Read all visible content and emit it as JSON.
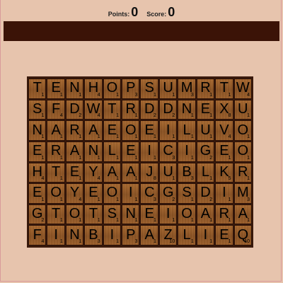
{
  "header": {
    "points_label": "Points:",
    "points_value": "0",
    "score_label": "Score:",
    "score_value": "0"
  },
  "board": {
    "rows": [
      [
        [
          "T",
          "1"
        ],
        [
          "E",
          "1"
        ],
        [
          "N",
          "1"
        ],
        [
          "H",
          "4"
        ],
        [
          "O",
          "1"
        ],
        [
          "P",
          "3"
        ],
        [
          "S",
          "1"
        ],
        [
          "U",
          "1"
        ],
        [
          "M",
          "3"
        ],
        [
          "R",
          "1"
        ],
        [
          "T",
          "1"
        ],
        [
          "W",
          "4"
        ]
      ],
      [
        [
          "S",
          "1"
        ],
        [
          "F",
          "4"
        ],
        [
          "D",
          "2"
        ],
        [
          "W",
          "4"
        ],
        [
          "T",
          "1"
        ],
        [
          "R",
          "1"
        ],
        [
          "D",
          "2"
        ],
        [
          "D",
          "2"
        ],
        [
          "N",
          "1"
        ],
        [
          "E",
          "1"
        ],
        [
          "X",
          "8"
        ],
        [
          "U",
          "1"
        ]
      ],
      [
        [
          "N",
          "1"
        ],
        [
          "A",
          "1"
        ],
        [
          "R",
          "1"
        ],
        [
          "A",
          "1"
        ],
        [
          "E",
          "1"
        ],
        [
          "O",
          "1"
        ],
        [
          "E",
          "1"
        ],
        [
          "I",
          "1"
        ],
        [
          "L",
          "1"
        ],
        [
          "U",
          "1"
        ],
        [
          "V",
          "4"
        ],
        [
          "O",
          "1"
        ]
      ],
      [
        [
          "E",
          "1"
        ],
        [
          "R",
          "1"
        ],
        [
          "A",
          "1"
        ],
        [
          "N",
          "1"
        ],
        [
          "L",
          "1"
        ],
        [
          "E",
          "1"
        ],
        [
          "I",
          "1"
        ],
        [
          "C",
          "3"
        ],
        [
          "I",
          "1"
        ],
        [
          "G",
          "2"
        ],
        [
          "E",
          "1"
        ],
        [
          "O",
          "1"
        ]
      ],
      [
        [
          "H",
          "4"
        ],
        [
          "T",
          "1"
        ],
        [
          "E",
          "1"
        ],
        [
          "Y",
          "4"
        ],
        [
          "A",
          "1"
        ],
        [
          "A",
          "1"
        ],
        [
          "J",
          "8"
        ],
        [
          "U",
          "1"
        ],
        [
          "B",
          "3"
        ],
        [
          "L",
          "1"
        ],
        [
          "K",
          "5"
        ],
        [
          "R",
          "1"
        ]
      ],
      [
        [
          "E",
          "1"
        ],
        [
          "O",
          "1"
        ],
        [
          "Y",
          "4"
        ],
        [
          "E",
          "1"
        ],
        [
          "O",
          "1"
        ],
        [
          "I",
          "1"
        ],
        [
          "C",
          "3"
        ],
        [
          "G",
          "2"
        ],
        [
          "S",
          "1"
        ],
        [
          "D",
          "2"
        ],
        [
          "I",
          "1"
        ],
        [
          "M",
          "3"
        ]
      ],
      [
        [
          "G",
          "2"
        ],
        [
          "T",
          "1"
        ],
        [
          "O",
          "1"
        ],
        [
          "T",
          "1"
        ],
        [
          "S",
          "1"
        ],
        [
          "N",
          "1"
        ],
        [
          "E",
          "1"
        ],
        [
          "I",
          "1"
        ],
        [
          "O",
          "1"
        ],
        [
          "A",
          "1"
        ],
        [
          "R",
          "1"
        ],
        [
          "A",
          "1"
        ]
      ],
      [
        [
          "F",
          "4"
        ],
        [
          "I",
          "1"
        ],
        [
          "N",
          "1"
        ],
        [
          "B",
          "3"
        ],
        [
          "I",
          "1"
        ],
        [
          "P",
          "3"
        ],
        [
          "A",
          "1"
        ],
        [
          "Z",
          "10"
        ],
        [
          "L",
          "1"
        ],
        [
          "I",
          "1"
        ],
        [
          "E",
          "1"
        ],
        [
          "Q",
          "10"
        ]
      ]
    ]
  }
}
